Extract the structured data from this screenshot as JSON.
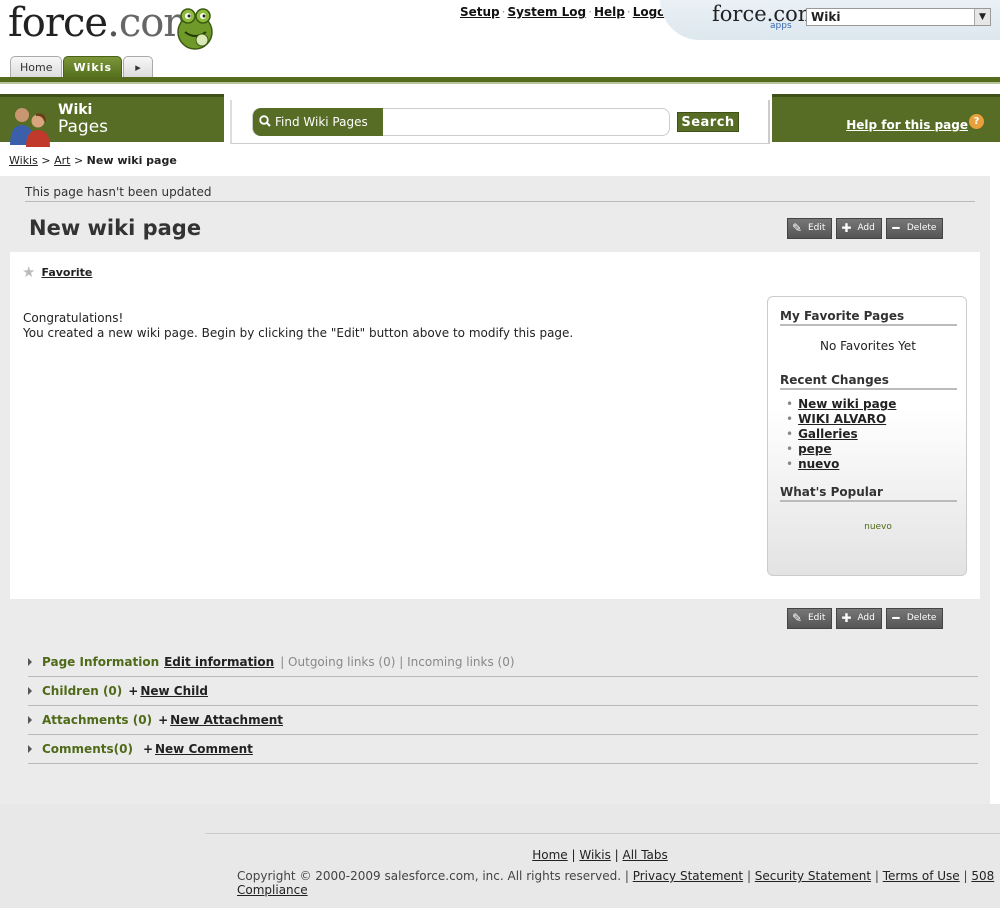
{
  "header": {
    "logo_force": "force",
    "logo_dot": ".",
    "logo_com": "com",
    "links": [
      "Setup",
      "System Log",
      "Help",
      "Logout"
    ],
    "app_logo": "force.com",
    "app_logo_apps": "apps",
    "app_select": "Wiki",
    "tabs": [
      {
        "label": "Home",
        "active": false
      },
      {
        "label": "Wikis",
        "active": true
      }
    ]
  },
  "wiki_band": {
    "title_line1": "Wiki",
    "title_line2": "Pages",
    "find_label": "Find Wiki Pages",
    "search_value": "",
    "search_button": "Search",
    "help_link": "Help for this page",
    "help_icon": "?"
  },
  "breadcrumb": {
    "wikis": "Wikis",
    "art": "Art",
    "current": "New wiki page",
    "sep": ">"
  },
  "page": {
    "updated_text": "This page hasn't been updated",
    "title": "New wiki page",
    "actions": {
      "edit": "Edit",
      "add": "Add",
      "delete": "Delete"
    },
    "favorite": "Favorite",
    "body_line1": "Congratulations!",
    "body_line2": "You created a new wiki page. Begin by clicking the \"Edit\" button above to modify this page."
  },
  "sidebar": {
    "favorites_heading": "My Favorite Pages",
    "favorites_empty": "No Favorites Yet",
    "recent_heading": "Recent Changes",
    "recent": [
      "New wiki page",
      "WIKI ALVARO",
      "Galleries",
      "pepe",
      "nuevo"
    ],
    "popular_heading": "What's Popular",
    "popular_item": "nuevo"
  },
  "sections": {
    "page_info": {
      "label": "Page Information",
      "link": "Edit information",
      "extra": "| Outgoing links (0) | Incoming links (0)"
    },
    "children": {
      "label": "Children (0)",
      "plus": "+",
      "link": "New Child"
    },
    "attachments": {
      "label": "Attachments (0)",
      "plus": "+",
      "link": "New Attachment"
    },
    "comments": {
      "label": "Comments(0)",
      "plus": "+",
      "link": "New Comment"
    }
  },
  "footer": {
    "links": [
      "Home",
      "Wikis",
      "All Tabs"
    ],
    "copyright": "Copyright © 2000-2009 salesforce.com, inc. All rights reserved. |",
    "legal": [
      "Privacy Statement",
      "Security Statement",
      "Terms of Use",
      "508 Compliance"
    ]
  }
}
